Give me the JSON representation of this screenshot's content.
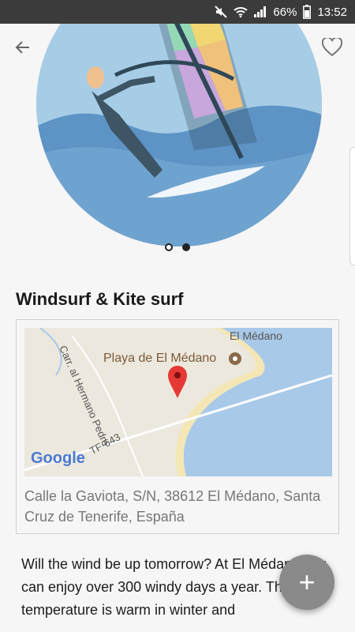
{
  "status_bar": {
    "battery": "66%",
    "time": "13:52",
    "icons": [
      "mute-icon",
      "wifi-icon",
      "signal-icon",
      "battery-icon"
    ]
  },
  "nav": {
    "back_icon": "back-arrow-icon",
    "favorite_icon": "heart-outline-icon"
  },
  "carousel": {
    "pages": 2,
    "current": 1
  },
  "title": "Windsurf & Kite surf",
  "map": {
    "labels": {
      "town": "El Médano",
      "beach": "Playa de El Médano",
      "road1": "Carr. al Hermano Pedro",
      "road2": "TF-643"
    },
    "logo": "Google"
  },
  "address": "Calle la Gaviota, S/N, 38612 El Médano, Santa Cruz de Tenerife, España",
  "description": "Will the wind be up tomorrow? At El Médano you can enjoy over 300 windy days a year. The water temperature is warm in winter and",
  "fab_label": "+"
}
